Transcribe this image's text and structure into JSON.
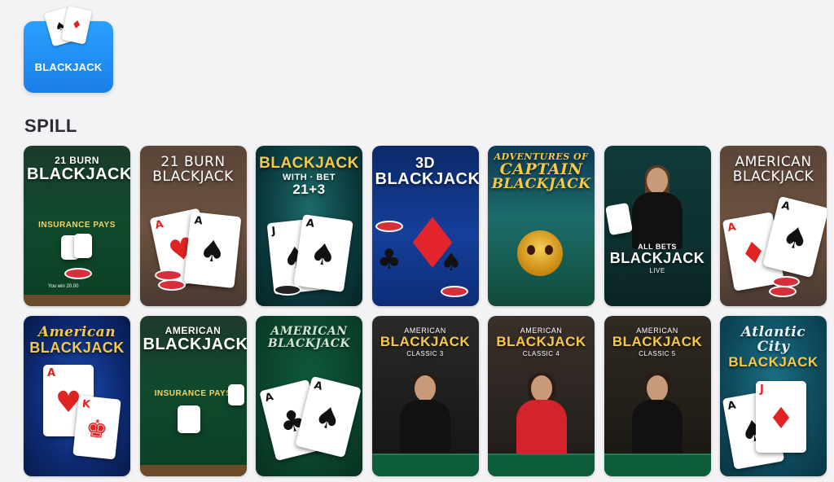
{
  "category": {
    "label": "BLACKJACK",
    "icon": "playing-cards-icon"
  },
  "section": {
    "title": "SPILL"
  },
  "games": [
    {
      "name": "21 Burn Blackjack",
      "line1": "21 BURN",
      "line2": "BLACKJACK",
      "felt_text": "INSURANCE PAYS",
      "chips_text": "You win 20.00"
    },
    {
      "name": "21 Burn Blackjack",
      "line1": "21 BURN",
      "line2": "BLACKJACK"
    },
    {
      "name": "Blackjack with 21+3 Bet",
      "line1": "BLACKJACK",
      "line2": "21+3",
      "line3": "WITH · BET"
    },
    {
      "name": "3D Blackjack",
      "line1": "3D",
      "line2": "BLACKJACK"
    },
    {
      "name": "Adventures of Captain Blackjack",
      "line1": "ADVENTURES OF",
      "line2": "CAPTAIN",
      "line3": "BLACKJACK"
    },
    {
      "name": "All Bets Blackjack Live",
      "line1": "ALL BETS",
      "line2": "BLACKJACK",
      "line3": "LIVE"
    },
    {
      "name": "American Blackjack",
      "line1": "AMERICAN",
      "line2": "BLACKJACK"
    },
    {
      "name": "American Blackjack",
      "line1": "American",
      "line2": "BLACKJACK"
    },
    {
      "name": "American Blackjack",
      "line1": "AMERICAN",
      "line2": "BLACKJACK",
      "felt_text": "INSURANCE PAYS"
    },
    {
      "name": "American Blackjack",
      "line1": "AMERICAN",
      "line2": "BLACKJACK"
    },
    {
      "name": "American Blackjack Classic 3",
      "line1": "AMERICAN",
      "line2": "BLACKJACK",
      "line3": "CLASSIC 3"
    },
    {
      "name": "American Blackjack Classic 4",
      "line1": "AMERICAN",
      "line2": "BLACKJACK",
      "line3": "CLASSIC 4"
    },
    {
      "name": "American Blackjack Classic 5",
      "line1": "AMERICAN",
      "line2": "BLACKJACK",
      "line3": "CLASSIC 5"
    },
    {
      "name": "Atlantic City Blackjack",
      "line1": "Atlantic City",
      "line2": "BLACKJACK"
    }
  ]
}
